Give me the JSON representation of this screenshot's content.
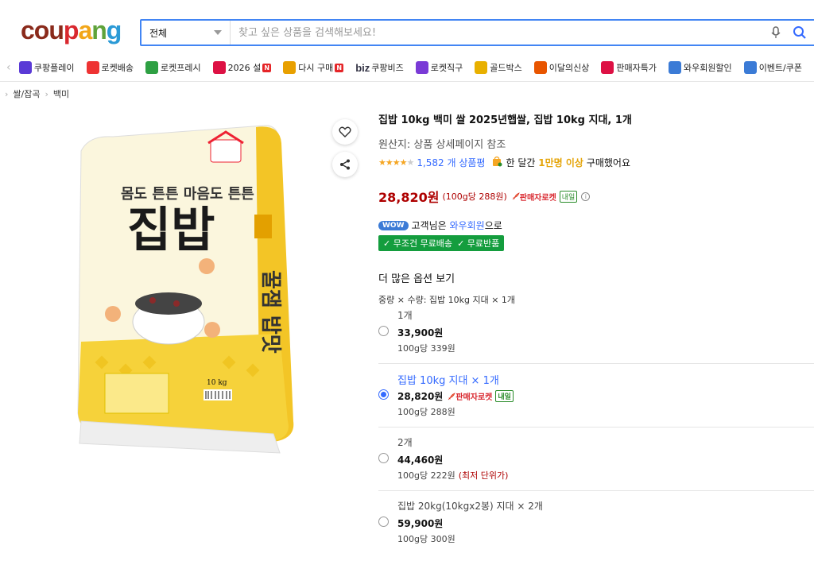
{
  "logo": {
    "p1": "cou",
    "p2": "p",
    "p3": "a",
    "p4": "n",
    "p5": "g"
  },
  "search": {
    "category": "전체",
    "placeholder": "찾고 싶은 상품을 검색해보세요!"
  },
  "nav": {
    "items": [
      {
        "label": "쿠팡플레이",
        "icon": "play-icon",
        "color": "#5a3ad6"
      },
      {
        "label": "로켓배송",
        "icon": "rocket-icon",
        "color": "#e33"
      },
      {
        "label": "로켓프레시",
        "icon": "rocket-fresh-icon",
        "color": "#2ea043"
      },
      {
        "label": "2026 설",
        "icon": "gift-icon",
        "color": "#d14",
        "badge": "N"
      },
      {
        "label": "다시 구매",
        "icon": "home-icon",
        "color": "#e8a000",
        "badge": "N"
      },
      {
        "label": "쿠팡비즈",
        "icon": "biz-icon",
        "color": "#111",
        "prefix": "biz"
      },
      {
        "label": "로켓직구",
        "icon": "globe-rocket-icon",
        "color": "#7a3ad6"
      },
      {
        "label": "골드박스",
        "icon": "goldbox-icon",
        "color": "#e8b000"
      },
      {
        "label": "이달의신상",
        "icon": "new-bag-icon",
        "color": "#e85500"
      },
      {
        "label": "판매자특가",
        "icon": "percent-icon",
        "color": "#d14"
      },
      {
        "label": "와우회원할인",
        "icon": "wow-icon",
        "color": "#3b7bd6"
      },
      {
        "label": "이벤트/쿠폰",
        "icon": "event-icon",
        "color": "#3b7bd6"
      }
    ]
  },
  "breadcrumb": {
    "level1": "쌀/잡곡",
    "level2": "백미"
  },
  "product": {
    "title": "집밥 10kg 백미 쌀 2025년햅쌀, 집밥 10kg 지대, 1개",
    "origin": "원산지: 상품 상세페이지 참조",
    "rating": 4.5,
    "review_count": "1,582 개 상품평",
    "purchase_pre": "한 달간",
    "purchase_count": "1만명 이상",
    "purchase_post": "구매했어요",
    "price": "28,820원",
    "unit_price": "(100g당 288원)",
    "rocket_label": "판매자로켓",
    "tomorrow": "내일",
    "wow_badge": "WOW",
    "wow_pre": "고객님은",
    "wow_member": "와우회원",
    "wow_post": "으로",
    "free_shipping": "✓ 무조건 무료배송",
    "free_return": "✓ 무료반품",
    "more_options": "더 많은 옵션 보기",
    "option_summary": "중량 × 수량: 집밥 10kg 지대 × 1개",
    "image_text": {
      "pkg_name": "집밥",
      "weight": "10 kg"
    }
  },
  "options": [
    {
      "name": "1개",
      "price": "33,900원",
      "unit": "100g당 339원",
      "selected": false
    },
    {
      "name": "집밥 10kg 지대 × 1개",
      "price": "28,820원",
      "unit": "100g당 288원",
      "selected": true,
      "rocket": "판매자로켓",
      "tomorrow": "내일"
    },
    {
      "name": "2개",
      "price": "44,460원",
      "unit": "100g당 222원",
      "note": "(최저 단위가)",
      "selected": false
    },
    {
      "name": "집밥 20kg(10kgx2봉) 지대 × 2개",
      "price": "59,900원",
      "unit": "100g당 300원",
      "selected": false
    }
  ]
}
